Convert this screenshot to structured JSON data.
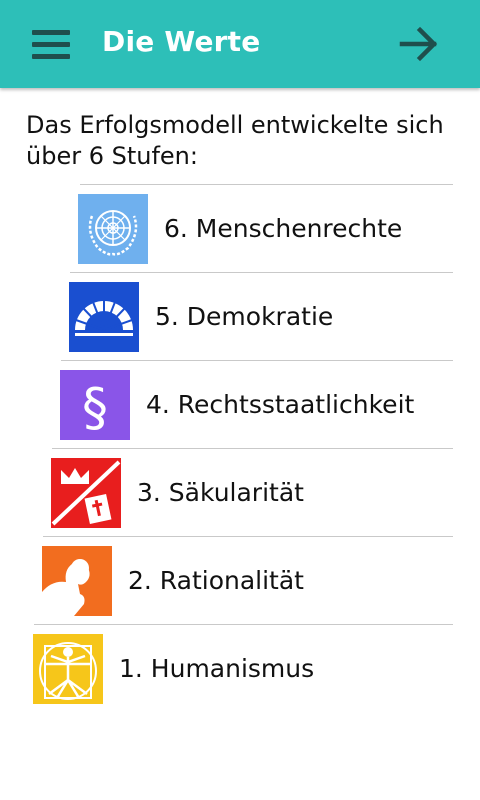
{
  "header": {
    "title": "Die Werte",
    "menu_icon": "hamburger-menu-icon",
    "next_icon": "arrow-right-icon",
    "background": "#2dbfb8"
  },
  "intro": "Das Erfolgsmodell entwickelte sich über 6 Stufen:",
  "stages": [
    {
      "label": "6. Menschenrechte",
      "icon": "un-emblem-icon",
      "color": "#6fb0ee"
    },
    {
      "label": "5. Demokratie",
      "icon": "parliament-icon",
      "color": "#1a4fd0"
    },
    {
      "label": "4. Rechtsstaatlichkeit",
      "icon": "paragraph-icon",
      "color": "#8a55e8"
    },
    {
      "label": "3. Säkularität",
      "icon": "crown-bible-icon",
      "color": "#e81e1e"
    },
    {
      "label": "2. Rationalität",
      "icon": "thinker-icon",
      "color": "#f26d1f"
    },
    {
      "label": "1. Humanismus",
      "icon": "vitruvian-man-icon",
      "color": "#f6c61a"
    }
  ]
}
